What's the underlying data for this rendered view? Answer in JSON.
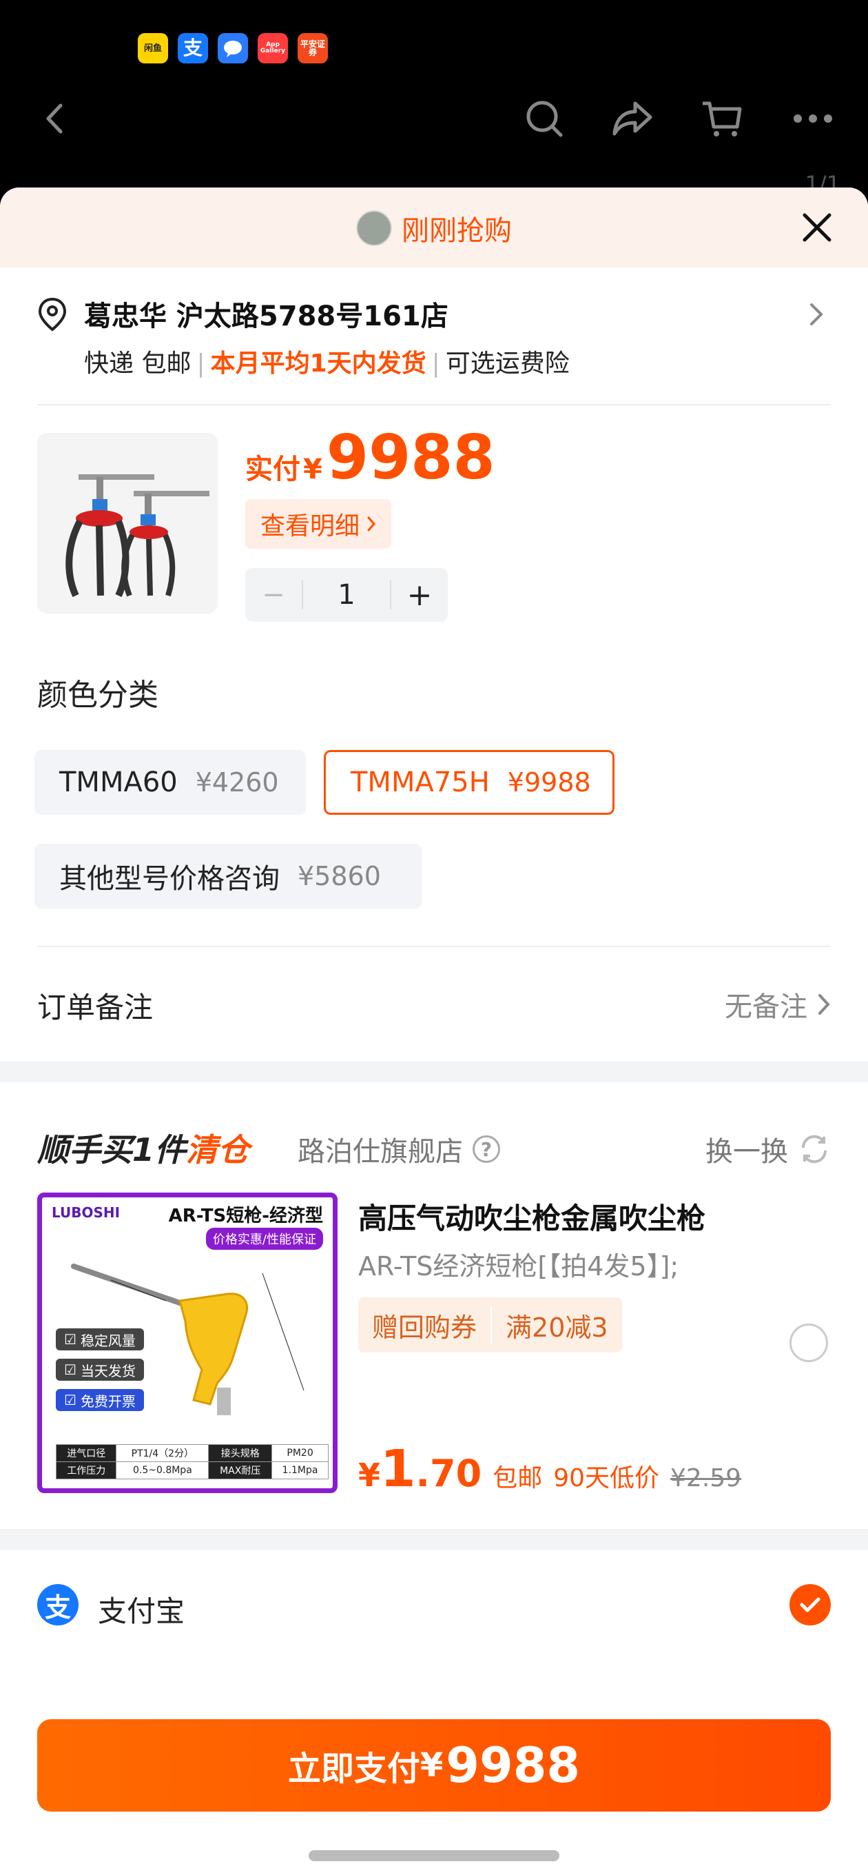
{
  "status_bar": {
    "apps": [
      {
        "label": "闲鱼",
        "icon": "xianyu-icon",
        "color": "#ffd400",
        "fg": "#222"
      },
      {
        "label": "支",
        "icon": "alipay-icon",
        "color": "#1677ff",
        "fg": "#fff"
      },
      {
        "label": "…",
        "icon": "message-icon",
        "color": "#2a7bff",
        "fg": "#fff"
      },
      {
        "label": "App Gallery",
        "icon": "app-gallery-icon",
        "color": "#ff3b3b",
        "fg": "#fff"
      },
      {
        "label": "平安证券",
        "icon": "pingan-icon",
        "color": "#f24a1d",
        "fg": "#fff"
      }
    ]
  },
  "page_indicator": "1/1",
  "sheet": {
    "title": "刚刚抢购"
  },
  "address": {
    "name": "葛忠华 沪太路5788号161店",
    "delivery": "快递 包邮",
    "ship_time": "本月平均1天内发货",
    "insurance": "可选运费险"
  },
  "product": {
    "price_label": "实付",
    "currency": "¥",
    "price": "9988",
    "detail_label": "查看明细",
    "quantity": "1",
    "minus": "−",
    "plus": "+"
  },
  "variant": {
    "title": "颜色分类",
    "options": [
      {
        "name": "TMMA60",
        "price": "¥4260",
        "selected": false
      },
      {
        "name": "TMMA75H",
        "price": "¥9988",
        "selected": true
      },
      {
        "name": "其他型号价格咨询",
        "price": "¥5860",
        "selected": false
      }
    ]
  },
  "remark": {
    "label": "订单备注",
    "value": "无备注"
  },
  "addon": {
    "title_prefix": "顺手买1件",
    "title_highlight": "清仓",
    "store": "路泊仕旗舰店",
    "help": "?",
    "swap_label": "换一换",
    "image": {
      "brand": "LUBOSHI",
      "model": "AR-TS短枪-经济型",
      "tag": "价格实惠/性能保证",
      "features": [
        "稳定风量",
        "当天发货",
        "免费开票"
      ],
      "spec_rows": [
        [
          "进气口径",
          "PT1/4（2分）",
          "接头规格",
          "PM20"
        ],
        [
          "工作压力",
          "0.5~0.8Mpa",
          "MAX耐压",
          "1.1Mpa"
        ]
      ]
    },
    "name": "高压气动吹尘枪金属吹尘枪",
    "spec": "AR-TS经济短枪[【拍4发5】];",
    "coupons": [
      "赠回购券",
      "满20减3"
    ],
    "price_currency": "¥",
    "price_int": "1",
    "price_dec": ".70",
    "shipping": "包邮",
    "low_price": "90天低价",
    "original_price": "¥2.59"
  },
  "payment": {
    "method": "支付宝",
    "logo_char": "支",
    "selected": true
  },
  "pay_button": {
    "label": "立即支付",
    "currency": "¥",
    "amount": "9988"
  },
  "colors": {
    "accent": "#ff5000",
    "alipay": "#1677ff",
    "image_border": "#8a1cd0"
  }
}
